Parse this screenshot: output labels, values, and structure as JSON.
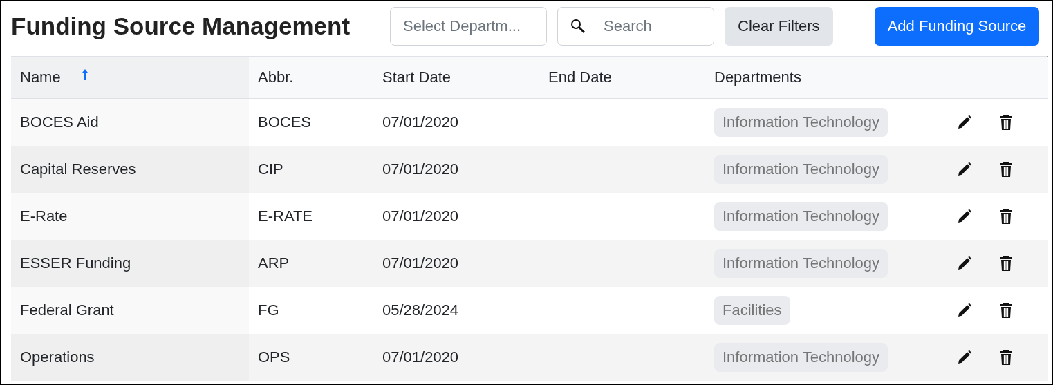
{
  "title": "Funding Source Management",
  "toolbar": {
    "department_select": {
      "placeholder": "Select Departm..."
    },
    "search": {
      "placeholder": "Search"
    },
    "clear_button": "Clear Filters",
    "add_button": "Add Funding Source"
  },
  "table": {
    "columns": [
      {
        "label": "Name",
        "sorted": true
      },
      {
        "label": "Abbr.",
        "sorted": false
      },
      {
        "label": "Start Date",
        "sorted": false
      },
      {
        "label": "End Date",
        "sorted": false
      },
      {
        "label": "Departments",
        "sorted": false
      }
    ],
    "rows": [
      {
        "name": "BOCES Aid",
        "abbr": "BOCES",
        "start_date": "07/01/2020",
        "departments": [
          "Information Technology"
        ]
      },
      {
        "name": "Capital Reserves",
        "abbr": "CIP",
        "start_date": "07/01/2020",
        "departments": [
          "Information Technology"
        ]
      },
      {
        "name": "E-Rate",
        "abbr": "E-RATE",
        "start_date": "07/01/2020",
        "departments": [
          "Information Technology"
        ]
      },
      {
        "name": "ESSER Funding",
        "abbr": "ARP",
        "start_date": "07/01/2020",
        "departments": [
          "Information Technology"
        ]
      },
      {
        "name": "Federal Grant",
        "abbr": "FG",
        "start_date": "05/28/2024",
        "departments": [
          "Facilities"
        ]
      },
      {
        "name": "Operations",
        "abbr": "OPS",
        "start_date": "07/01/2020",
        "departments": [
          "Information Technology"
        ]
      }
    ]
  }
}
